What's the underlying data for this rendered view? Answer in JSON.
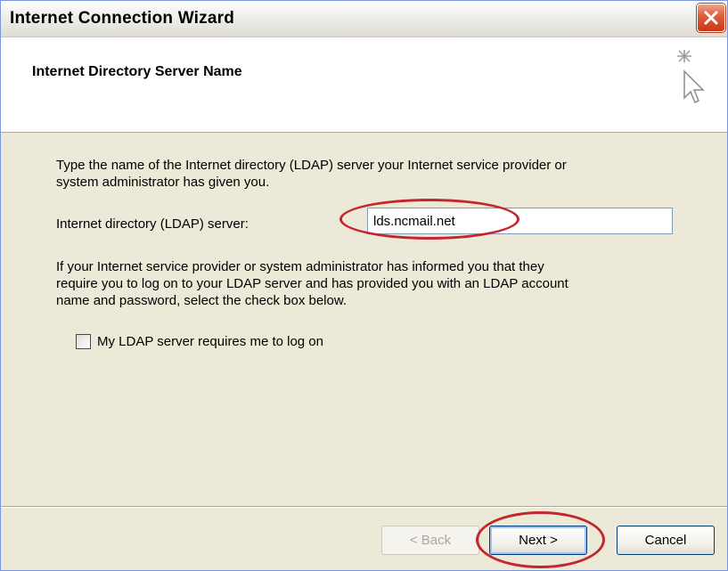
{
  "window": {
    "title": "Internet Connection Wizard",
    "close_icon": "close-x-icon"
  },
  "header": {
    "title": "Internet Directory Server Name",
    "icon": "wizard-sparkle-cursor-icon"
  },
  "content": {
    "intro_line1": "Type the name of the Internet directory (LDAP) server your Internet service provider or",
    "intro_line2": "system administrator has given you.",
    "server_label": "Internet directory (LDAP) server:",
    "server_value": "lds.ncmail.net",
    "info_line1": "If your Internet service provider or system administrator has informed you that they",
    "info_line2": "require you to log on to your LDAP server and has provided you with an LDAP account",
    "info_line3": "name and password, select the check box below.",
    "checkbox_label": "My LDAP server requires me to log on",
    "checkbox_checked": false
  },
  "buttons": {
    "back": "< Back",
    "next": "Next >",
    "cancel": "Cancel"
  },
  "colors": {
    "annotation_red": "#c3262c",
    "dialog_bg": "#ece9d8",
    "close_button": "#e0603e"
  }
}
